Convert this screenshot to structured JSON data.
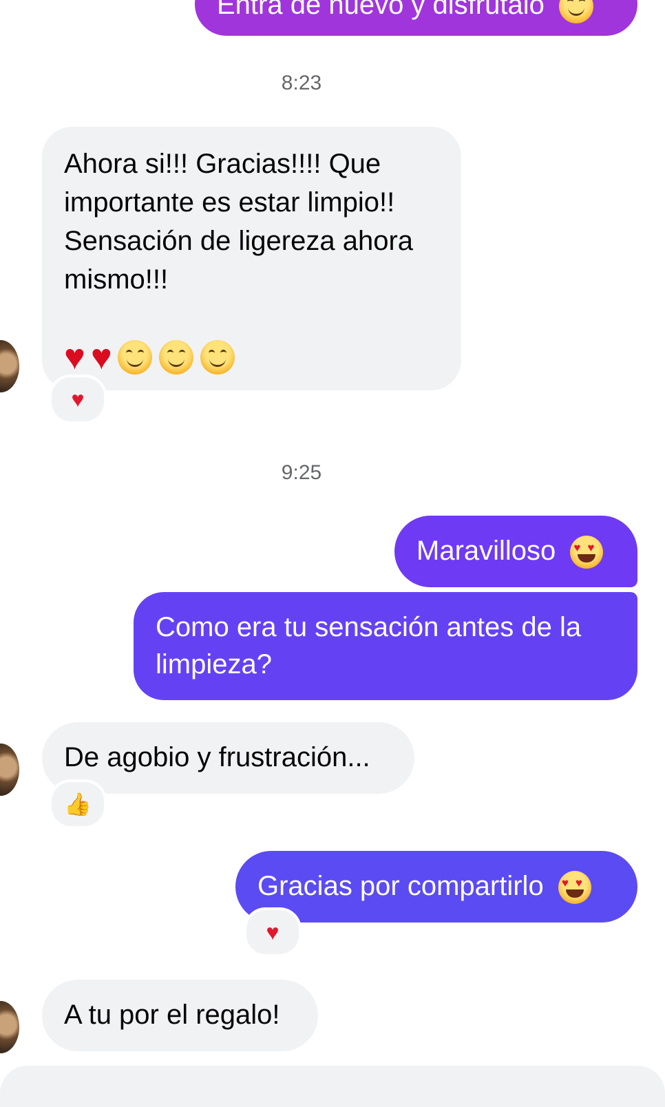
{
  "colors": {
    "incoming_bg": "#f1f2f4",
    "outgoing_top": "#a033dc",
    "outgoing_mid": "#6a3ef3",
    "outgoing_bottom": "#5c4cf4",
    "timestamp": "#65676b"
  },
  "messages": {
    "m0": {
      "text": "Entra de nuevo y disfrutalo",
      "emoji": "smiling-face-icon"
    },
    "time1": "8:23",
    "m1": {
      "text": "Ahora si!!! Gracias!!!! Que importante es estar limpio!! Sensación de ligereza ahora mismo!!!",
      "emojis": [
        "red-heart-icon",
        "red-heart-icon",
        "smiling-face-icon",
        "smiling-face-icon",
        "smiling-face-icon"
      ],
      "reaction": "❤️"
    },
    "time2": "9:25",
    "m2": {
      "text": "Maravilloso",
      "emoji": "heart-eyes-icon"
    },
    "m3": {
      "text": "Como era tu sensación antes de la limpieza?"
    },
    "m4": {
      "text": "De agobio y frustración...",
      "reaction": "👍"
    },
    "m5": {
      "text": "Gracias por compartirlo",
      "emoji": "heart-eyes-icon",
      "reaction": "❤️"
    },
    "m6": {
      "text": "A tu por el regalo!"
    }
  }
}
